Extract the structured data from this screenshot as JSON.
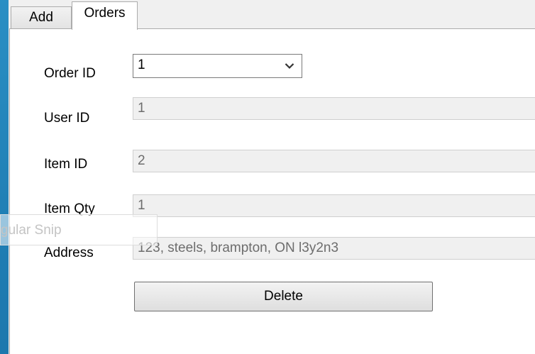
{
  "tabs": [
    {
      "label": "Add",
      "selected": false
    },
    {
      "label": "Orders",
      "selected": true
    }
  ],
  "form": {
    "order_id": {
      "label": "Order ID",
      "value": "1"
    },
    "user_id": {
      "label": "User ID",
      "value": "1"
    },
    "item_id": {
      "label": "Item ID",
      "value": "2"
    },
    "item_qty": {
      "label": "Item Qty",
      "value": "1"
    },
    "address": {
      "label": "Address",
      "value": "123, steels, brampton, ON l3y2n3"
    }
  },
  "delete_label": "Delete",
  "overlay": {
    "text": "gular Snip"
  },
  "icons": {
    "dropdown": "chevron-down-icon"
  },
  "colors": {
    "desktop": "#1f7db3",
    "readonly_field_bg": "#f0f0f0",
    "readonly_text": "#6d6d6d"
  }
}
